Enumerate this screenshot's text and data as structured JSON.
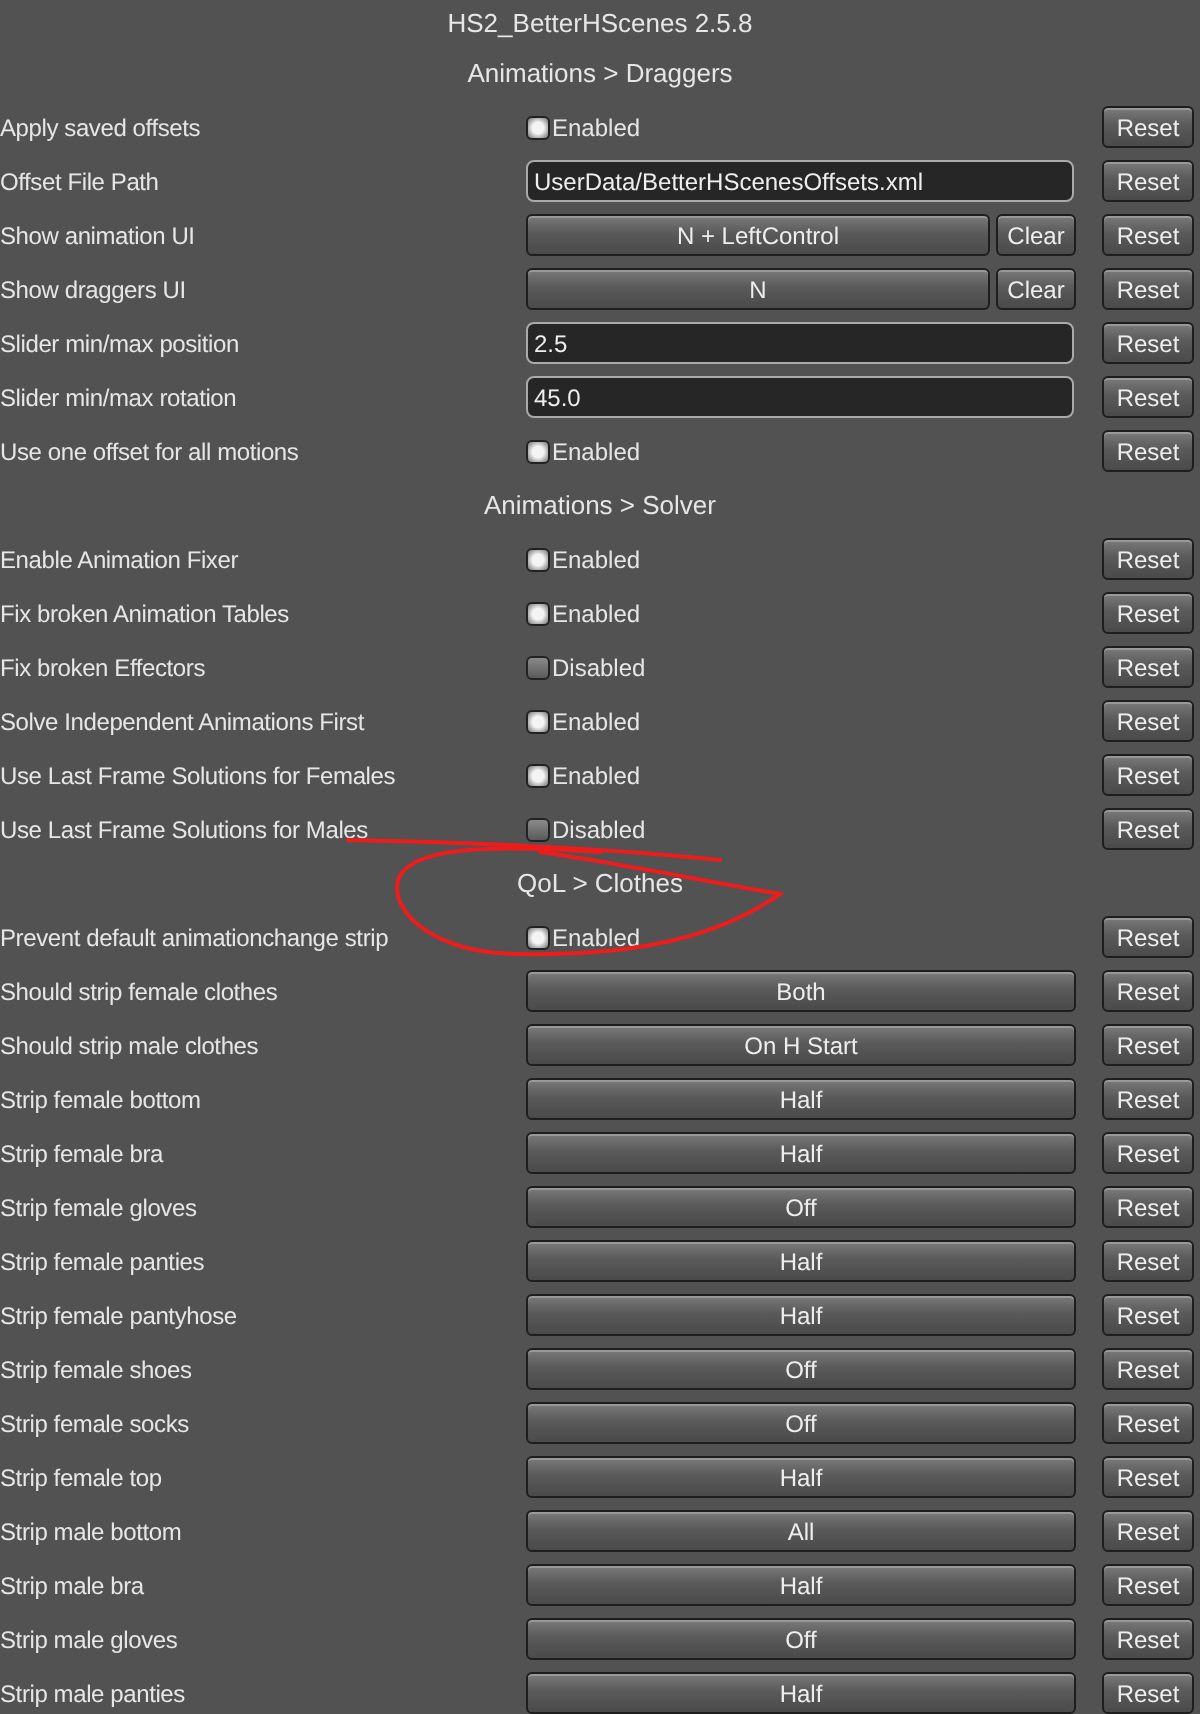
{
  "window": {
    "title": "HS2_BetterHScenes 2.5.8"
  },
  "sections": [
    {
      "title": "Animations > Draggers",
      "rows": [
        {
          "kind": "toggle",
          "label": "Apply saved offsets",
          "on": true,
          "state_text": "Enabled",
          "reset": "Reset"
        },
        {
          "kind": "text",
          "label": "Offset File Path",
          "value": "UserData/BetterHScenesOffsets.xml",
          "reset": "Reset"
        },
        {
          "kind": "hotkey",
          "label": "Show animation UI",
          "value": "N + LeftControl",
          "clear": "Clear",
          "reset": "Reset"
        },
        {
          "kind": "hotkey",
          "label": "Show draggers UI",
          "value": "N",
          "clear": "Clear",
          "reset": "Reset"
        },
        {
          "kind": "text",
          "label": "Slider min/max position",
          "value": "2.5",
          "reset": "Reset"
        },
        {
          "kind": "text",
          "label": "Slider min/max rotation",
          "value": "45.0",
          "reset": "Reset"
        },
        {
          "kind": "toggle",
          "label": "Use one offset for all motions",
          "on": true,
          "state_text": "Enabled",
          "reset": "Reset"
        }
      ]
    },
    {
      "title": "Animations > Solver",
      "rows": [
        {
          "kind": "toggle",
          "label": "Enable Animation Fixer",
          "on": true,
          "state_text": "Enabled",
          "reset": "Reset"
        },
        {
          "kind": "toggle",
          "label": "Fix broken Animation Tables",
          "on": true,
          "state_text": "Enabled",
          "reset": "Reset"
        },
        {
          "kind": "toggle",
          "label": "Fix broken Effectors",
          "on": false,
          "state_text": "Disabled",
          "reset": "Reset"
        },
        {
          "kind": "toggle",
          "label": "Solve Independent Animations First",
          "on": true,
          "state_text": "Enabled",
          "reset": "Reset"
        },
        {
          "kind": "toggle",
          "label": "Use Last Frame Solutions for Females",
          "on": true,
          "state_text": "Enabled",
          "reset": "Reset"
        },
        {
          "kind": "toggle",
          "label": "Use Last Frame Solutions for Males",
          "on": false,
          "state_text": "Disabled",
          "reset": "Reset"
        }
      ]
    },
    {
      "title": "QoL > Clothes",
      "rows": [
        {
          "kind": "toggle",
          "label": "Prevent default animationchange strip",
          "on": true,
          "state_text": "Enabled",
          "reset": "Reset"
        },
        {
          "kind": "choice",
          "label": "Should strip female clothes",
          "value": "Both",
          "reset": "Reset"
        },
        {
          "kind": "choice",
          "label": "Should strip male clothes",
          "value": "On H Start",
          "reset": "Reset"
        },
        {
          "kind": "choice",
          "label": "Strip female bottom",
          "value": "Half",
          "reset": "Reset"
        },
        {
          "kind": "choice",
          "label": "Strip female bra",
          "value": "Half",
          "reset": "Reset"
        },
        {
          "kind": "choice",
          "label": "Strip female gloves",
          "value": "Off",
          "reset": "Reset"
        },
        {
          "kind": "choice",
          "label": "Strip female panties",
          "value": "Half",
          "reset": "Reset"
        },
        {
          "kind": "choice",
          "label": "Strip female pantyhose",
          "value": "Half",
          "reset": "Reset"
        },
        {
          "kind": "choice",
          "label": "Strip female shoes",
          "value": "Off",
          "reset": "Reset"
        },
        {
          "kind": "choice",
          "label": "Strip female socks",
          "value": "Off",
          "reset": "Reset"
        },
        {
          "kind": "choice",
          "label": "Strip female top",
          "value": "Half",
          "reset": "Reset"
        },
        {
          "kind": "choice",
          "label": "Strip male bottom",
          "value": "All",
          "reset": "Reset"
        },
        {
          "kind": "choice",
          "label": "Strip male bra",
          "value": "Half",
          "reset": "Reset"
        },
        {
          "kind": "choice",
          "label": "Strip male gloves",
          "value": "Off",
          "reset": "Reset"
        },
        {
          "kind": "choice",
          "label": "Strip male panties",
          "value": "Half",
          "reset": "Reset"
        }
      ]
    }
  ]
}
